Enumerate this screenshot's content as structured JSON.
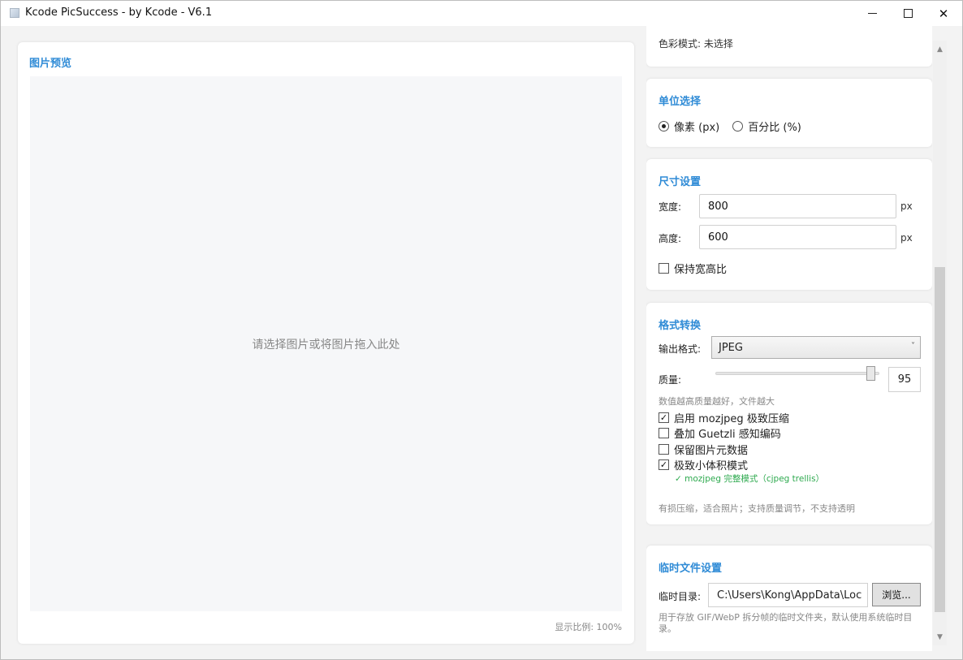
{
  "window": {
    "title": "Kcode PicSuccess - by Kcode - V6.1"
  },
  "preview": {
    "title": "图片预览",
    "placeholder": "请选择图片或将图片拖入此处",
    "scale_label": "显示比例: 100%"
  },
  "color_mode": {
    "label": "色彩模式: 未选择"
  },
  "unit": {
    "title": "单位选择",
    "options": [
      {
        "label": "像素 (px)",
        "selected": true
      },
      {
        "label": "百分比 (%)",
        "selected": false
      }
    ]
  },
  "size": {
    "title": "尺寸设置",
    "width_label": "宽度:",
    "width_value": "800",
    "height_label": "高度:",
    "height_value": "600",
    "unit_suffix": "px",
    "keep_ratio_label": "保持宽高比",
    "keep_ratio_checked": false
  },
  "format": {
    "title": "格式转换",
    "output_label": "输出格式:",
    "output_value": "JPEG",
    "quality_label": "质量:",
    "quality_value": "95",
    "quality_hint": "数值越高质量越好，文件越大",
    "options": [
      {
        "label": "启用 mozjpeg 极致压缩",
        "checked": true
      },
      {
        "label": "叠加 Guetzli 感知编码",
        "checked": false
      },
      {
        "label": "保留图片元数据",
        "checked": false
      },
      {
        "label": "极致小体积模式",
        "checked": true
      }
    ],
    "mozjpeg_note": "✓ mozjpeg 完整模式（cjpeg trellis）",
    "description": "有损压缩，适合照片；支持质量调节，不支持透明"
  },
  "temp": {
    "title": "临时文件设置",
    "dir_label": "临时目录:",
    "dir_value": "C:\\Users\\Kong\\AppData\\Loc",
    "browse_label": "浏览...",
    "hint": "用于存放 GIF/WebP 拆分帧的临时文件夹，默认使用系统临时目录。"
  }
}
